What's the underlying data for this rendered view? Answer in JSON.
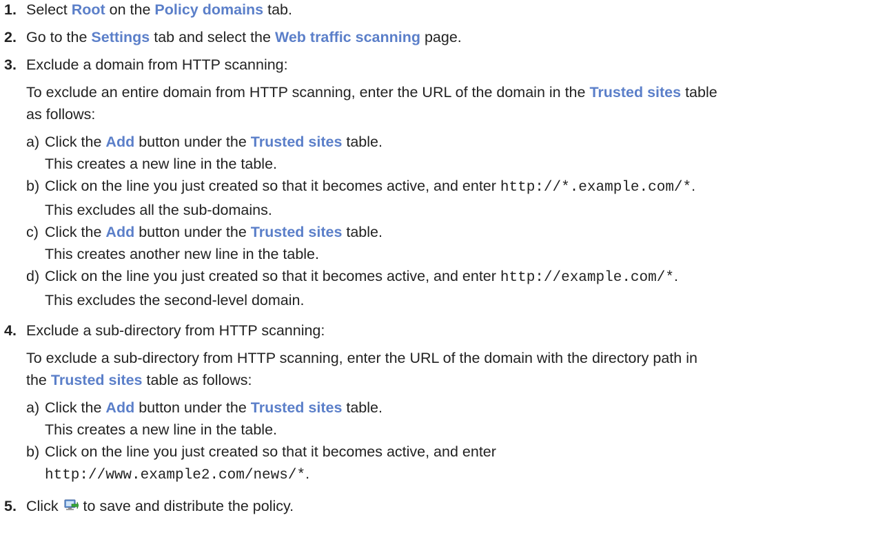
{
  "steps": [
    {
      "num": "1.",
      "pre": "Select ",
      "ui1": "Root",
      "mid": " on the ",
      "ui2": "Policy domains",
      "post": " tab."
    },
    {
      "num": "2.",
      "pre": "Go to the ",
      "ui1": "Settings",
      "mid": " tab and select the ",
      "ui2": "Web traffic scanning",
      "post": " page."
    },
    {
      "num": "3.",
      "title": "Exclude a domain from HTTP scanning:",
      "para_l1_pre": "To exclude an entire domain from HTTP scanning, enter the URL of the domain in the ",
      "para_l1_ui": "Trusted sites",
      "para_l1_post": " table",
      "para_l2": "as follows:",
      "sub": [
        {
          "letter": "a)",
          "pre": "Click the ",
          "ui1": "Add",
          "mid": " button under the ",
          "ui2": "Trusted sites",
          "post": " table.",
          "result": "This creates a new line in the table."
        },
        {
          "letter": "b)",
          "pre": "Click on the line you just created so that it becomes active, and enter ",
          "code": "http://*.example.com/*",
          "post": ".",
          "result": "This excludes all the sub-domains."
        },
        {
          "letter": "c)",
          "pre": "Click the ",
          "ui1": "Add",
          "mid": " button under the ",
          "ui2": "Trusted sites",
          "post": " table.",
          "result": "This creates another new line in the table."
        },
        {
          "letter": "d)",
          "pre": "Click on the line you just created so that it becomes active, and enter ",
          "code": "http://example.com/*",
          "post": ".",
          "result": "This excludes the second-level domain."
        }
      ]
    },
    {
      "num": "4.",
      "title": "Exclude a sub-directory from HTTP scanning:",
      "para_l1": "To exclude a sub-directory from HTTP scanning, enter the URL of the domain with the directory path in",
      "para_l2_pre": "the ",
      "para_l2_ui": "Trusted sites",
      "para_l2_post": " table as follows:",
      "sub": [
        {
          "letter": "a)",
          "pre": "Click the ",
          "ui1": "Add",
          "mid": " button under the ",
          "ui2": "Trusted sites",
          "post": " table.",
          "result": "This creates a new line in the table."
        },
        {
          "letter": "b)",
          "pre": "Click on the line you just created so that it becomes active, and enter",
          "code": "http://www.example2.com/news/*",
          "post": "."
        }
      ]
    },
    {
      "num": "5.",
      "pre": "Click ",
      "icon": "save-and-distribute-icon",
      "post": " to save and distribute the policy."
    }
  ],
  "colors": {
    "ui_text": "#5b7fc9",
    "body_text": "#222222"
  }
}
